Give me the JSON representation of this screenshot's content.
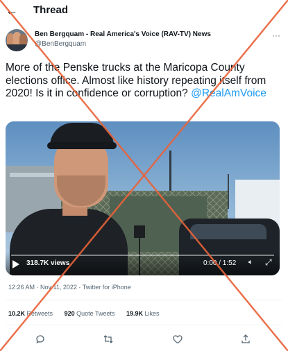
{
  "header": {
    "title": "Thread",
    "back_icon": "arrow-left-icon"
  },
  "author": {
    "name": "Ben Bergquam - Real America's Voice (RAV-TV) News",
    "handle": "@BenBergquam"
  },
  "tweet": {
    "text": "More of the Penske trucks at the Maricopa County elections office. Almost like history repeating itself from 2020! Is it in confidence or corruption? ",
    "mention": "@RealAmVoice"
  },
  "video": {
    "views": "318.7K views",
    "time": "0:00 / 1:52",
    "icons": [
      "play-icon",
      "volume-icon",
      "fullscreen-icon"
    ]
  },
  "meta": {
    "time": "12:26 AM",
    "separator1": " · ",
    "date": "Nov 11, 2022",
    "separator2": " · ",
    "source": "Twitter for iPhone"
  },
  "stats": {
    "retweets_count": "10.2K",
    "retweets_label": " Retweets",
    "quotes_count": "920",
    "quotes_label": " Quote Tweets",
    "likes_count": "19.9K",
    "likes_label": " Likes"
  },
  "actions": [
    "reply-icon",
    "retweet-icon",
    "like-icon",
    "share-icon"
  ],
  "colors": {
    "accent": "#1d9bf0",
    "cross": "#e8633a",
    "text": "#0f1419",
    "muted": "#536471"
  }
}
